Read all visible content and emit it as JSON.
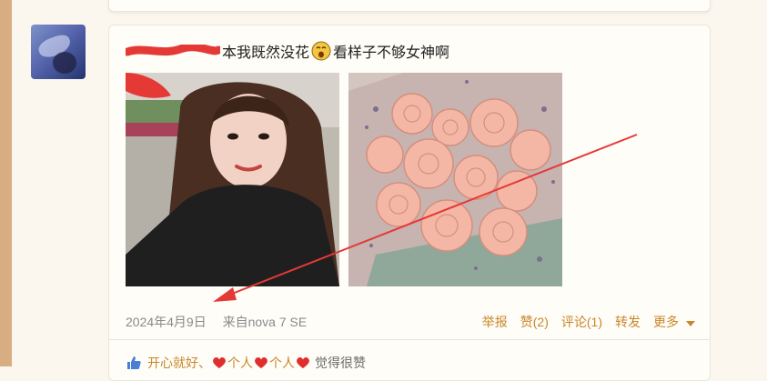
{
  "post": {
    "text": "本我既然没花",
    "text_after": "看样子不够女神啊",
    "date": "2024年4月9日",
    "source": "来自nova 7 SE"
  },
  "actions": {
    "report": "举报",
    "like": "赞(2)",
    "comment": "评论(1)",
    "repost": "转发",
    "more": "更多"
  },
  "likes_line": {
    "name1": "开心就好、",
    "name2": "个人",
    "name3": "个人",
    "suffix": "觉得很赞"
  },
  "colors": {
    "accent": "#c8862a",
    "annotation": "#e53935",
    "left_strip": "#d8ad82"
  }
}
